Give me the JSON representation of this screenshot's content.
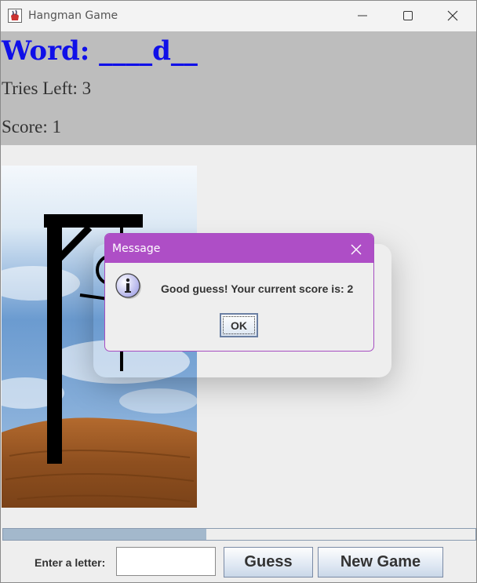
{
  "window": {
    "title": "Hangman Game",
    "icon": "java-cup-icon"
  },
  "game": {
    "word_label": "Word: ____d__",
    "tries_label": "Tries Left: 3",
    "score_label": "Score: 1",
    "progress_fraction": 0.43
  },
  "input": {
    "enter_label": "Enter a letter:",
    "value": "",
    "placeholder": ""
  },
  "buttons": {
    "guess": "Guess",
    "new_game": "New Game"
  },
  "dialog": {
    "title": "Message",
    "message": "Good guess! Your current score is: 2",
    "ok": "OK",
    "icon": "info-icon"
  },
  "colors": {
    "word": "#1010e8",
    "header_bg": "#bdbdbd",
    "dialog_accent": "#ae4ec6",
    "progress_fill": "#a3b8cc"
  }
}
